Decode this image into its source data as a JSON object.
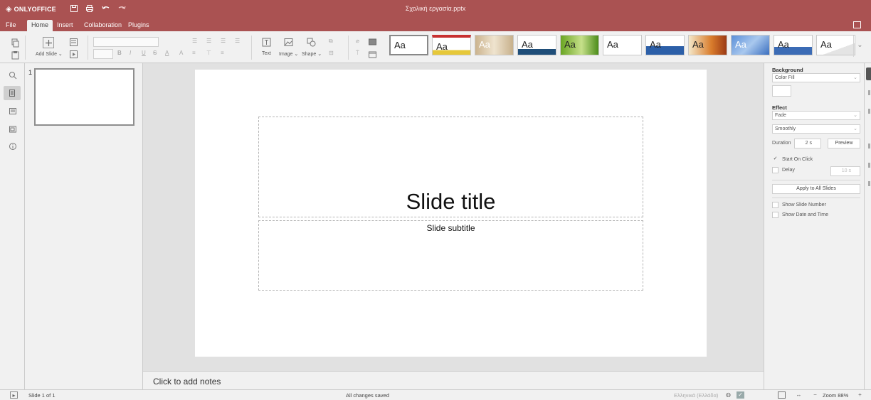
{
  "titlebar": {
    "logo": "ONLYOFFICE",
    "doc_title": "Σχολική εργασία.pptx"
  },
  "menu_tabs": [
    "File",
    "Home",
    "Insert",
    "Collaboration",
    "Plugins"
  ],
  "toolbar": {
    "add_slide": "Add Slide",
    "text": "Text",
    "image": "Image",
    "shape": "Shape",
    "theme_sample": "Aa"
  },
  "thumbnails": {
    "slide_number": "1"
  },
  "slide": {
    "title": "Slide title",
    "subtitle": "Slide subtitle"
  },
  "notes": {
    "placeholder": "Click to add notes"
  },
  "right_panel": {
    "background_heading": "Background",
    "fill_type": "Color Fill",
    "effect_heading": "Effect",
    "effect": "Fade",
    "effect_type": "Smoothly",
    "duration_label": "Duration",
    "duration_value": "2 s",
    "preview_button": "Preview",
    "start_on_click": "Start On Click",
    "start_on_click_checked": true,
    "delay_label": "Delay",
    "delay_value": "10 s",
    "apply_all": "Apply to All Slides",
    "show_slide_number": "Show Slide Number",
    "show_date_time": "Show Date and Time"
  },
  "statusbar": {
    "slide_counter": "Slide 1 of 1",
    "save_status": "All changes saved",
    "language": "Ελληνικά (Ελλάδα)",
    "zoom": "Zoom 88%"
  },
  "colors": {
    "brand": "#aa5252",
    "panel": "#f1f1f1",
    "canvas": "#e1e1e1"
  }
}
